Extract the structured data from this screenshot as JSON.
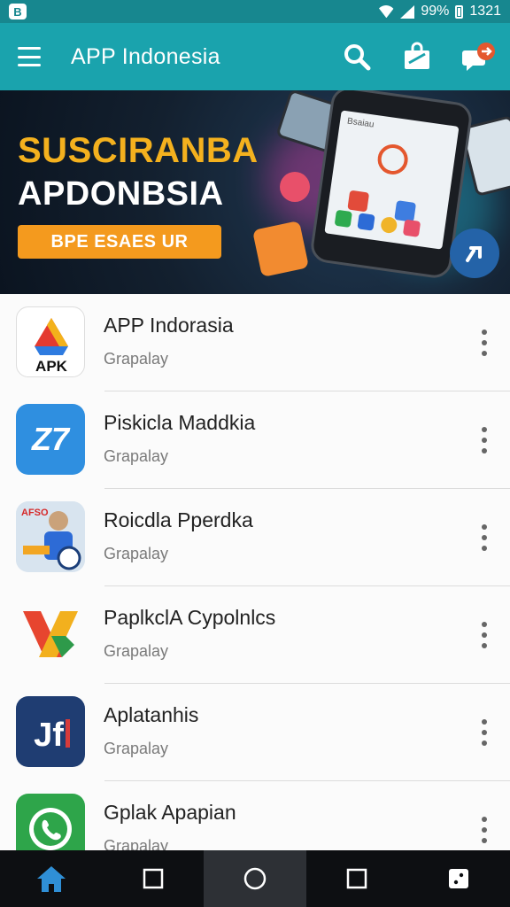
{
  "status_bar": {
    "battery": "99%",
    "time": "1321",
    "notif_glyph": "B"
  },
  "app_bar": {
    "title": "APP Indonesia",
    "actions": [
      "search-icon",
      "shopping-bag-icon",
      "chat-notification-icon"
    ]
  },
  "banner": {
    "headline": "SUSCIRANBA",
    "subheadline": "APDONBSIA",
    "cta_label": "BPE ESAES UR",
    "phone_screen_text": "Bsaiau",
    "colors": {
      "headline": "#f4b11e",
      "cta": "#f49a1e",
      "fab": "#2463a8"
    }
  },
  "apps": [
    {
      "name": "APP Indorasia",
      "publisher": "Grapalay",
      "icon": "apk-logo",
      "icon_text": "APK"
    },
    {
      "name": "Piskicla Maddkia",
      "publisher": "Grapalay",
      "icon": "z7-logo",
      "icon_text": "Z7"
    },
    {
      "name": "Roicdla Pperdka",
      "publisher": "Grapalay",
      "icon": "person-logo",
      "icon_text": "AFSO"
    },
    {
      "name": "PaplkclA Cypolnlcs",
      "publisher": "Grapalay",
      "icon": "x-logo"
    },
    {
      "name": "Aplatanhis",
      "publisher": "Grapalay",
      "icon": "jf-logo",
      "icon_text": "Jf"
    },
    {
      "name": "Gplak Apapian",
      "publisher": "Grapalay",
      "icon": "whatsapp-logo"
    }
  ],
  "bottom_nav": [
    "home-icon",
    "square-icon",
    "circle-icon",
    "square-icon",
    "dice-icon"
  ],
  "colors": {
    "status_bar": "#17878f",
    "app_bar": "#1aa3ad",
    "nav_bar": "#0d0f12",
    "nav_active": "#2f8fd6"
  }
}
